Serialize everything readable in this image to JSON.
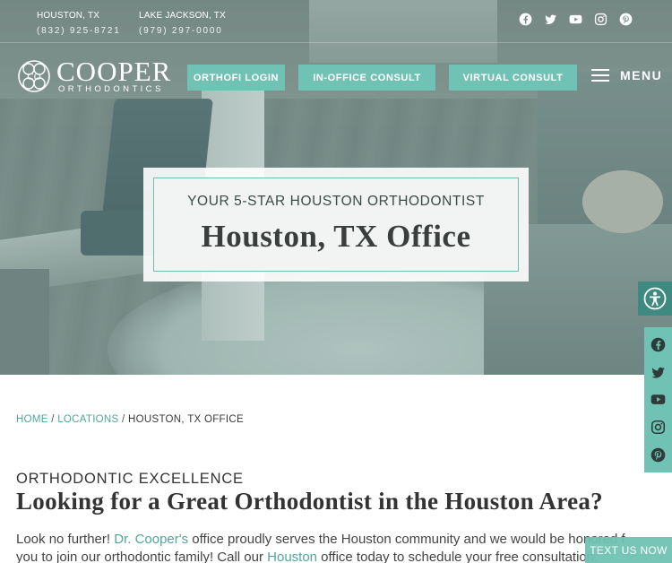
{
  "locations": [
    {
      "city": "HOUSTON, TX",
      "phone": "(832) 925-8721"
    },
    {
      "city": "LAKE JACKSON, TX",
      "phone": "(979) 297-0000"
    }
  ],
  "social_icons": [
    "facebook-icon",
    "twitter-icon",
    "youtube-icon",
    "instagram-icon",
    "pinterest-icon"
  ],
  "logo": {
    "brand": "COOPER",
    "sub": "ORTHODONTICS"
  },
  "nav": {
    "orthofi": "ORTHOFI LOGIN",
    "in_office": "IN-OFFICE CONSULT",
    "virtual": "VIRTUAL CONSULT",
    "menu": "MENU"
  },
  "hero": {
    "kicker": "YOUR 5-STAR HOUSTON ORTHODONTIST",
    "title": "Houston, TX Office"
  },
  "breadcrumb": {
    "home": "HOME",
    "locations": "LOCATIONS",
    "current": "HOUSTON, TX OFFICE",
    "separator": "/"
  },
  "content": {
    "eyebrow": "ORTHODONTIC EXCELLENCE",
    "heading": "Looking for a Great Orthodontist in the Houston Area?",
    "p1_a": "Look no further! ",
    "p1_link": "Dr. Cooper's",
    "p1_b": " office proudly serves the Houston community and we would be honored f",
    "p2_a": "you to join our orthodontic family! Call our ",
    "p2_link": "Houston",
    "p2_b": " office today to schedule your free consultation."
  },
  "text_now": "TEXT US NOW",
  "colors": {
    "accent": "#6fc2b4",
    "accent_dark": "#3e8a80",
    "link": "#4fa89a"
  }
}
